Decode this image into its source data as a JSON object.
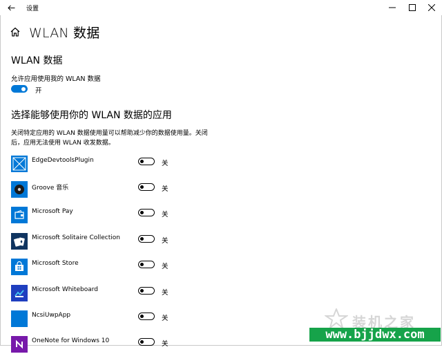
{
  "window": {
    "title": "设置"
  },
  "header": {
    "title": "WLAN 数据"
  },
  "section": {
    "title": "WLAN 数据",
    "allow_label": "允许应用使用我的 WLAN 数据",
    "toggle_state": "开"
  },
  "apps_section": {
    "title": "选择能够使用你的 WLAN 数据的应用",
    "description": "关闭特定应用的 WLAN 数据使用量可以帮助减少你的数据使用量。关闭后，应用无法使用 WLAN 收发数据。"
  },
  "apps": [
    {
      "name": "EdgeDevtoolsPlugin",
      "state": "关",
      "icon": "edge-devtools-icon",
      "color": "#0078d7"
    },
    {
      "name": "Groove 音乐",
      "state": "关",
      "icon": "groove-music-icon",
      "color": "#0078d7"
    },
    {
      "name": "Microsoft Pay",
      "state": "关",
      "icon": "wallet-icon",
      "color": "#0078d7"
    },
    {
      "name": "Microsoft Solitaire Collection",
      "state": "关",
      "icon": "solitaire-cards-icon",
      "color": "#0f3460"
    },
    {
      "name": "Microsoft Store",
      "state": "关",
      "icon": "store-bag-icon",
      "color": "#0078d7"
    },
    {
      "name": "Microsoft Whiteboard",
      "state": "关",
      "icon": "whiteboard-icon",
      "color": "#1f3fbf"
    },
    {
      "name": "NcsiUwpApp",
      "state": "关",
      "icon": "ncsi-app-icon",
      "color": "#0078d7"
    },
    {
      "name": "OneNote for Windows 10",
      "state": "关",
      "icon": "onenote-icon",
      "color": "#7719aa"
    }
  ],
  "watermark": {
    "site_name": "装机之家",
    "url": "www.bjjdwx.com"
  }
}
